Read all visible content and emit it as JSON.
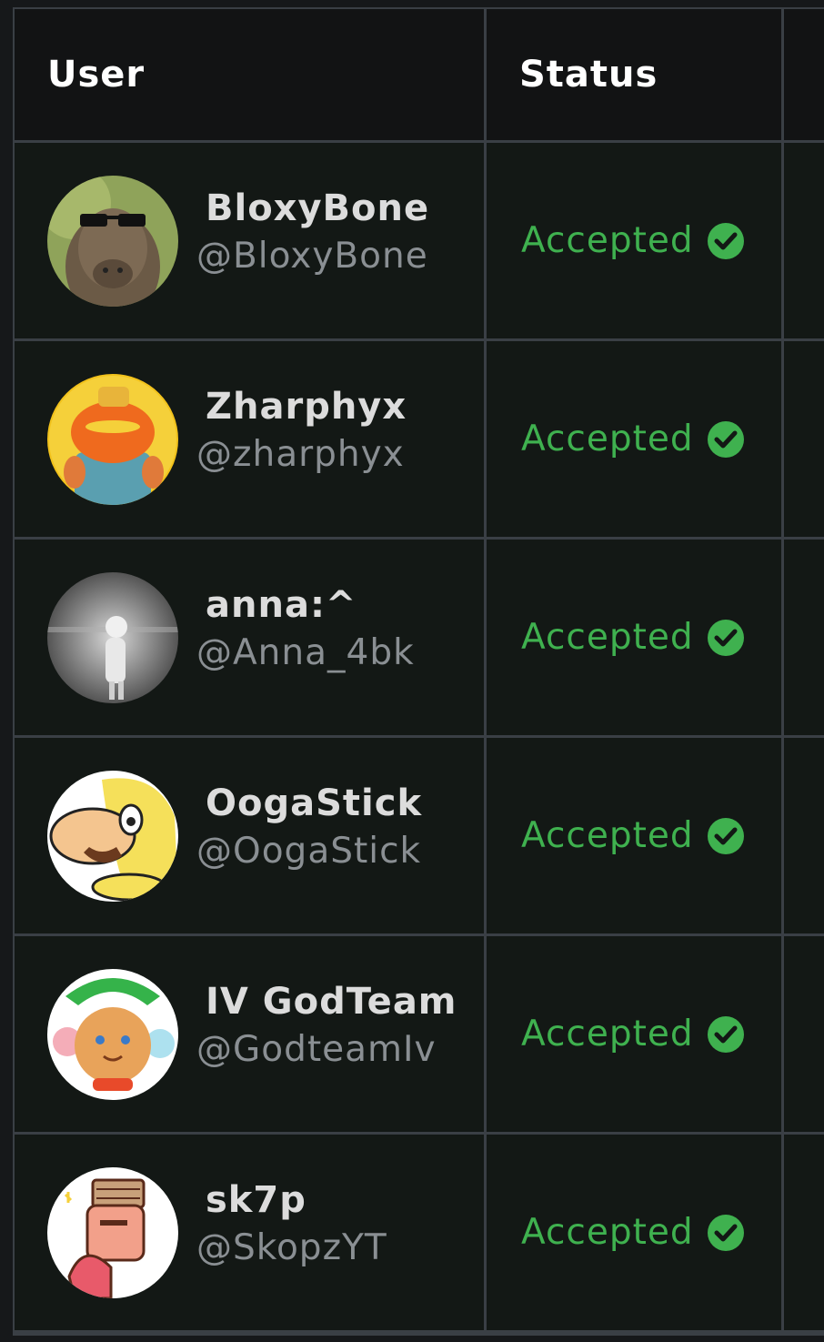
{
  "table": {
    "headers": {
      "user": "User",
      "status": "Status"
    },
    "rows": [
      {
        "display_name": "BloxyBone",
        "handle": "@BloxyBone",
        "status": "Accepted",
        "avatar_icon": "capybara-sunglasses-avatar"
      },
      {
        "display_name": "Zharphyx",
        "handle": "@zharphyx",
        "status": "Accepted",
        "avatar_icon": "orange-fish-avatar"
      },
      {
        "display_name": "anna:^",
        "handle": "@Anna_4bk",
        "status": "Accepted",
        "avatar_icon": "grayscale-figure-avatar"
      },
      {
        "display_name": "OogaStick",
        "handle": "@OogaStick",
        "status": "Accepted",
        "avatar_icon": "cartoon-character-avatar"
      },
      {
        "display_name": "IV GodTeam",
        "handle": "@GodteamIv",
        "status": "Accepted",
        "avatar_icon": "orange-cookie-avatar"
      },
      {
        "display_name": "sk7p",
        "handle": "@SkopzYT",
        "status": "Accepted",
        "avatar_icon": "pink-character-avatar"
      }
    ]
  },
  "colors": {
    "accent_green": "#3fb14f",
    "header_bg": "#121314",
    "row_bg": "#131815",
    "border": "#3a3f45"
  }
}
